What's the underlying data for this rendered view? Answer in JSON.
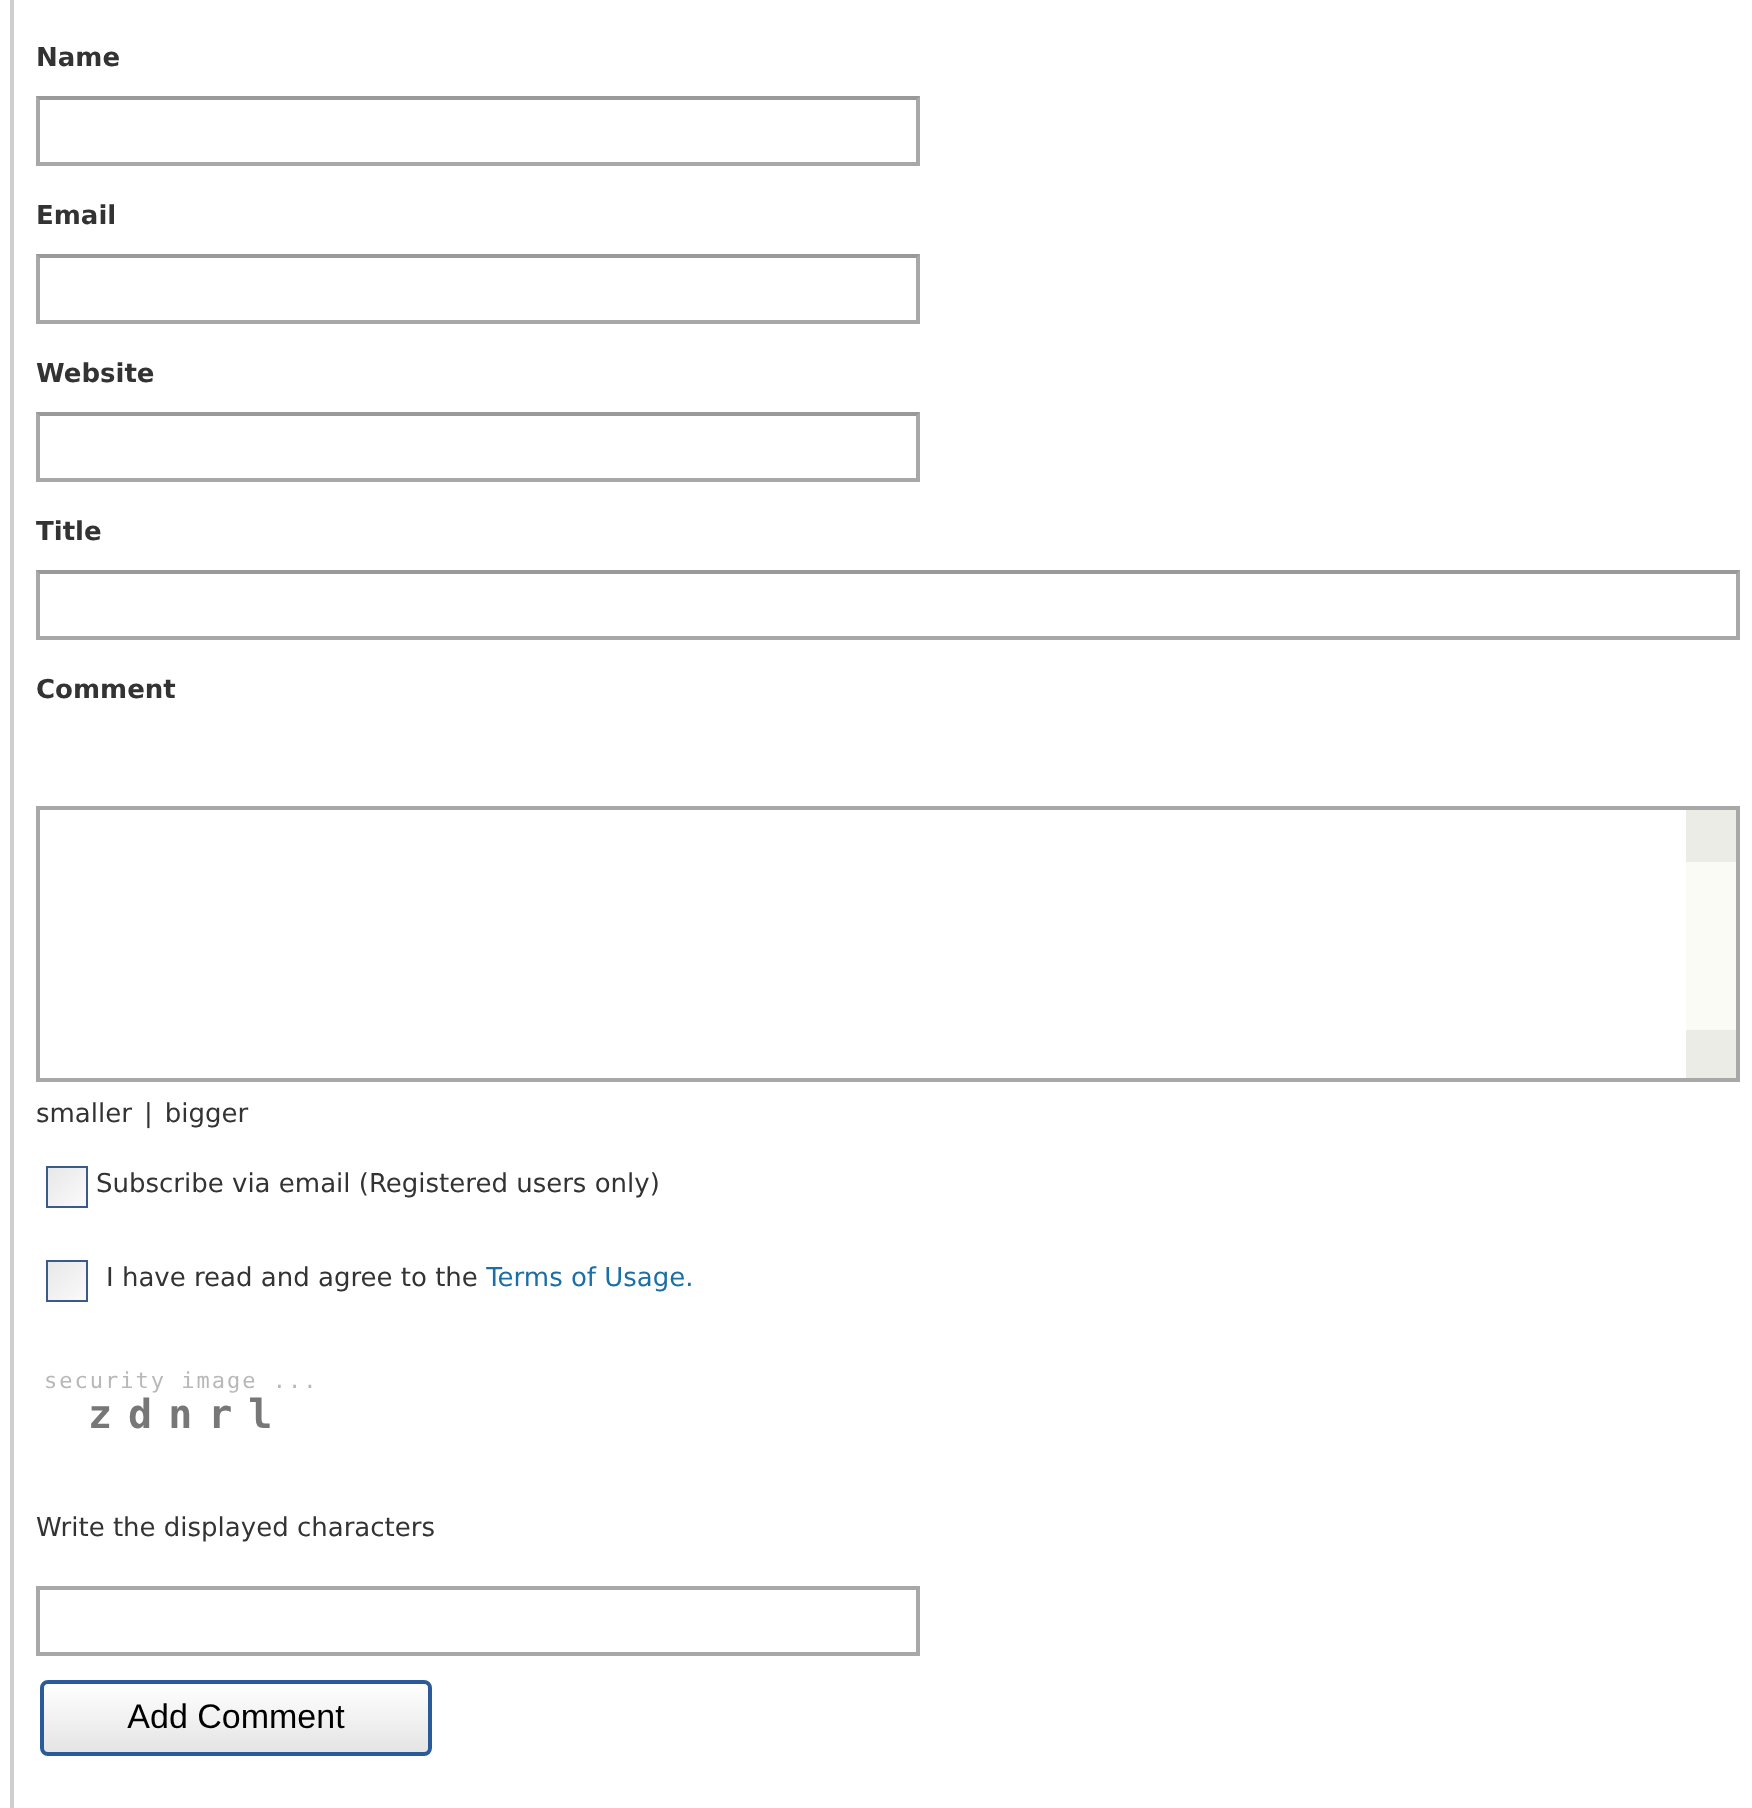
{
  "fields": [
    {
      "kind": "short_input",
      "label": "Name"
    },
    {
      "kind": "short_input",
      "label": "Email"
    },
    {
      "kind": "short_input",
      "label": "Website"
    },
    {
      "kind": "wide_input",
      "label": "Title"
    },
    {
      "kind": "textarea",
      "label": "Comment"
    }
  ],
  "resize_links": [
    {
      "label": "smaller"
    },
    {
      "label": "bigger"
    }
  ],
  "resize_separator": "|",
  "checkboxes": [
    {
      "label": "Subscribe via email (Registered users only)",
      "checked": false
    },
    {
      "label": "I have read and agree to the",
      "link": "Terms of Usage.",
      "checked": false
    }
  ],
  "captcha": {
    "caption": "security image ...",
    "code": "zdnrl"
  },
  "captcha_prompt": "Write the displayed characters",
  "submit": "Add Comment"
}
